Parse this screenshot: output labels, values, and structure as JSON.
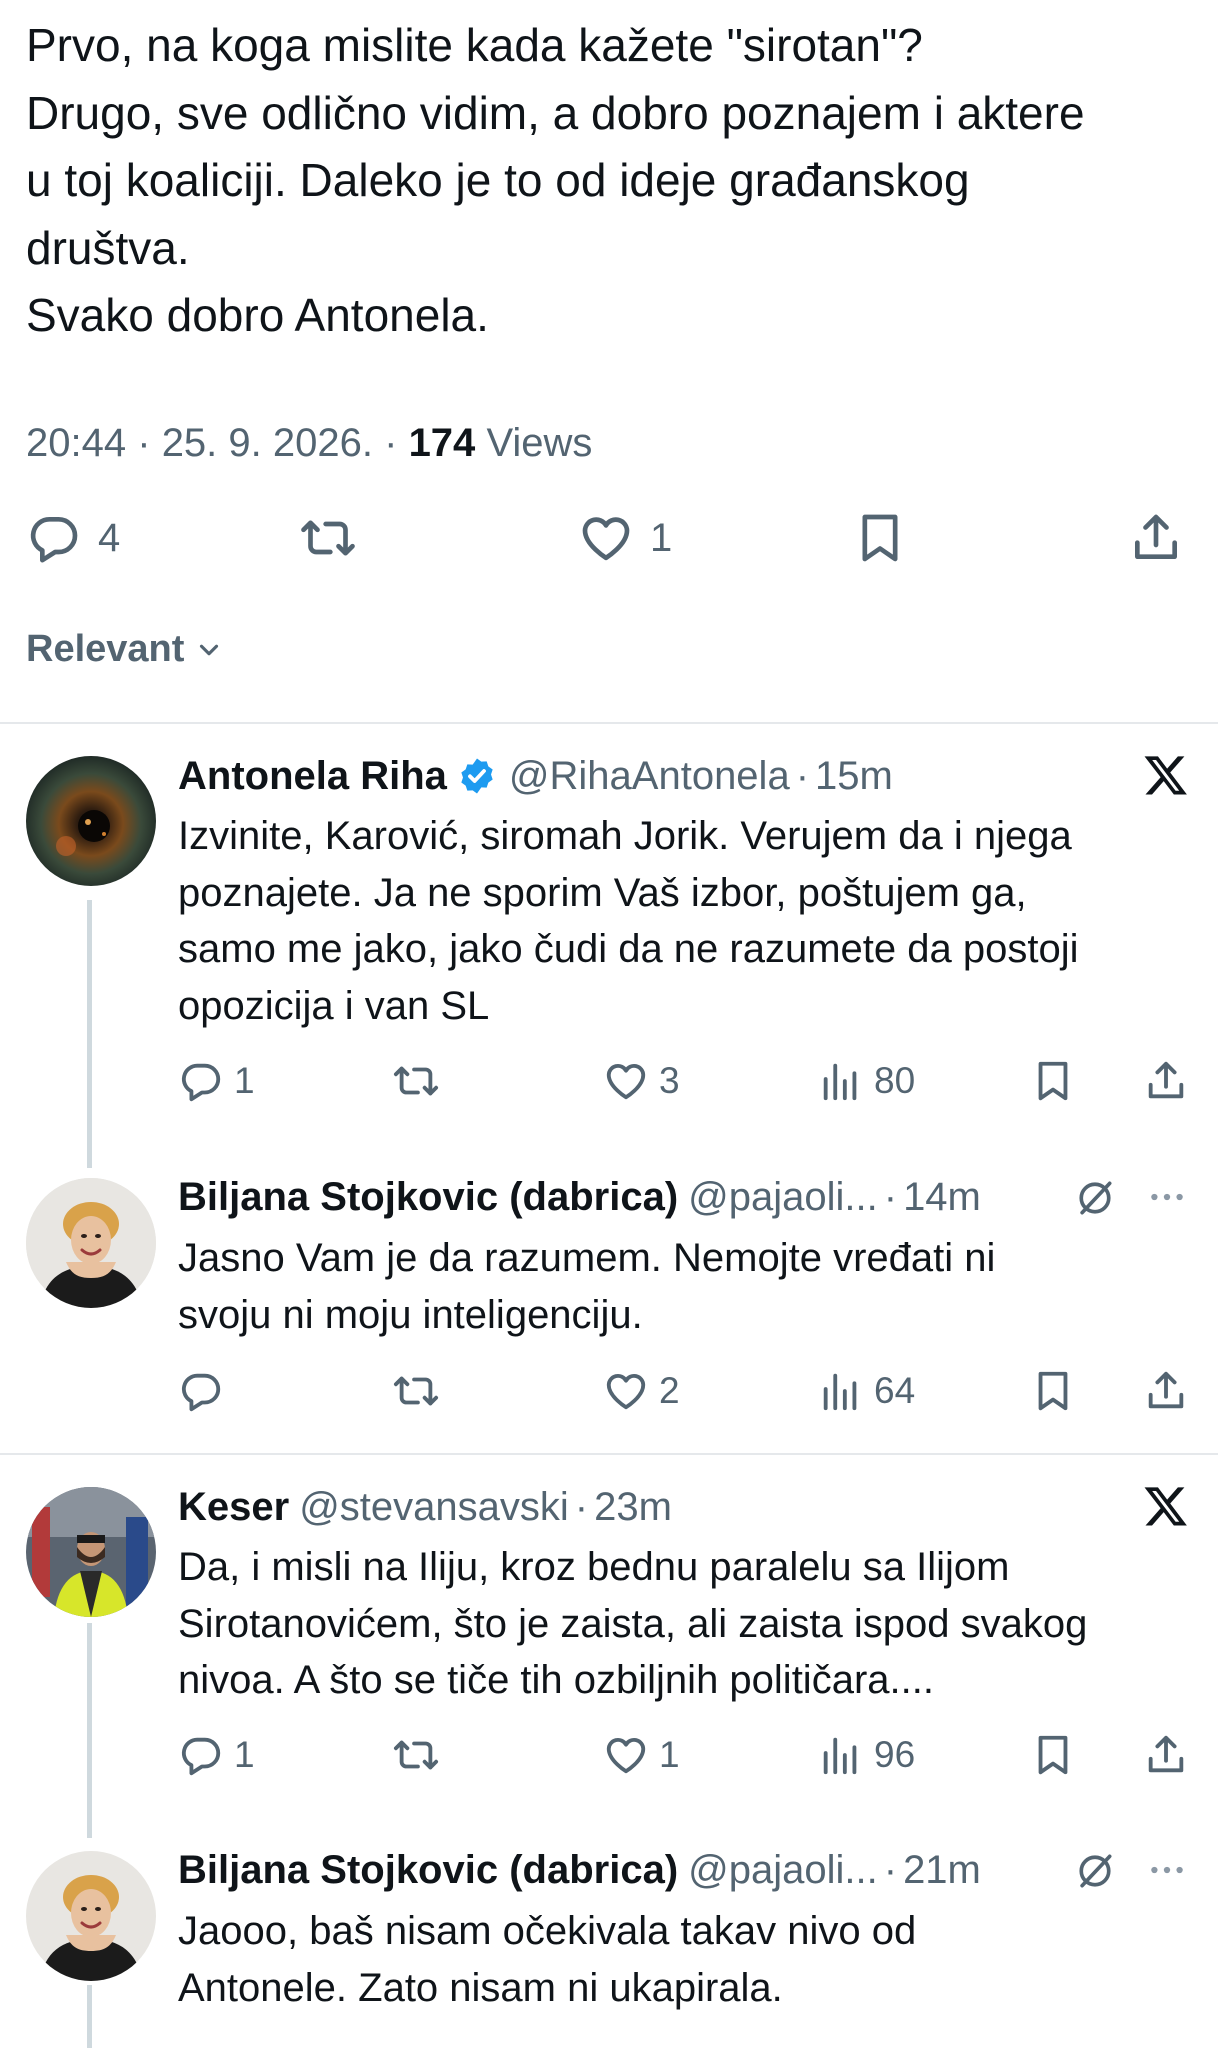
{
  "main_tweet": {
    "lines": [
      "Prvo, na koga mislite kada kažete \"sirotan\"?",
      "Drugo, sve odlično vidim, a dobro poznajem i aktere",
      "u toj koaliciji. Daleko je to od ideje građanskog",
      "društva.",
      "Svako dobro Antonela."
    ],
    "time": "20:44",
    "date": "25. 9. 2026.",
    "views_count": "174",
    "views_label": "Views",
    "reply_count": "4",
    "like_count": "1"
  },
  "sort": {
    "label": "Relevant"
  },
  "replies": [
    {
      "name": "Antonela Riha",
      "handle": "@RihaAntonela",
      "time": "15m",
      "lines": [
        "Izvinite, Karović, siromah Jorik. Verujem da i njega",
        "poznajete. Ja ne sporim Vaš izbor, poštujem ga,",
        "samo me jako, jako čudi da ne razumete da postoji",
        "opozicija i van SL"
      ],
      "replies": "1",
      "likes": "3",
      "views": "80"
    },
    {
      "name": "Biljana Stojkovic (dabrica)",
      "handle": "@pajaoli...",
      "time": "14m",
      "lines": [
        "Jasno Vam je da razumem. Nemojte vređati ni",
        "svoju ni moju inteligenciju."
      ],
      "replies": "",
      "likes": "2",
      "views": "64"
    },
    {
      "name": "Keser",
      "handle": "@stevansavski",
      "time": "23m",
      "lines": [
        "Da, i misli na Iliju, kroz bednu paralelu sa Ilijom",
        "Sirotanovićem, što je zaista, ali zaista ispod svakog",
        "nivoa. A što se tiče tih ozbiljnih političara...."
      ],
      "replies": "1",
      "likes": "1",
      "views": "96"
    },
    {
      "name": "Biljana Stojkovic (dabrica)",
      "handle": "@pajaoli...",
      "time": "21m",
      "lines": [
        "Jaooo, baš nisam očekivala takav nivo od",
        "Antonele. Zato nisam ni ukapirala."
      ]
    }
  ],
  "separator": "·",
  "colors": {
    "text": "#0f1419",
    "muted": "#536471",
    "verified": "#1d9bf0",
    "divider": "#e5e8eb"
  }
}
